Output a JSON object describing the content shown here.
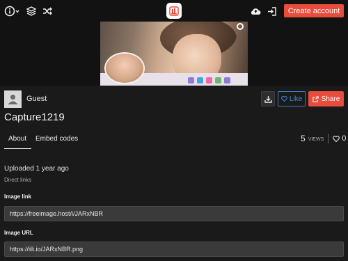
{
  "header": {
    "create_account_label": "Create account",
    "icons": [
      "info-icon",
      "layers-icon",
      "shuffle-icon",
      "logo-icon",
      "upload-icon",
      "sign-in-icon"
    ]
  },
  "user": {
    "name": "Guest"
  },
  "actions": {
    "like_label": "Like",
    "share_label": "Share"
  },
  "image": {
    "title": "Capture1219"
  },
  "tabs": [
    {
      "label": "About",
      "active": true
    },
    {
      "label": "Embed codes",
      "active": false
    }
  ],
  "stats": {
    "views": "5",
    "views_label": "VIEWS",
    "likes": "0"
  },
  "about": {
    "uploaded": "Uploaded 1 year ago",
    "direct_links": "Direct links",
    "image_link_label": "Image link",
    "image_link_value": "https://freeimage.host/i/JARxNBR",
    "image_url_label": "Image URL",
    "image_url_value": "https://iili.io/JARxNBR.png"
  },
  "colors": {
    "accent": "#e74c3c",
    "like": "#3f8fcf",
    "background": "#1a1a1a"
  }
}
